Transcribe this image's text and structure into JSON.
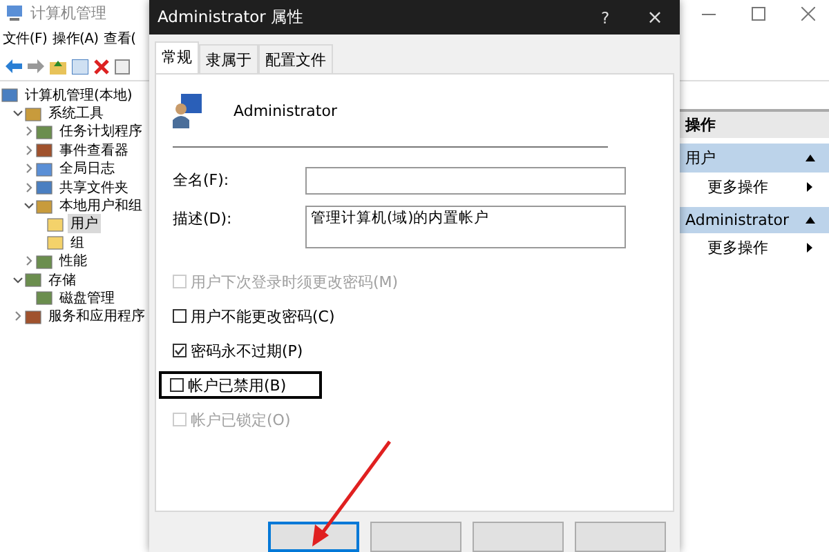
{
  "main_window": {
    "title": "计算机管理",
    "menu": [
      "文件(F)",
      "操作(A)",
      "查看("
    ],
    "tree": [
      {
        "label": "计算机管理(本地)",
        "selected": false,
        "children": [
          {
            "label": "系统工具",
            "expanded": true,
            "selected": false,
            "children": [
              {
                "label": "任务计划程序",
                "expanded": false,
                "selected": false
              },
              {
                "label": "事件查看器",
                "expanded": false,
                "selected": false
              },
              {
                "label": "全局日志",
                "expanded": false,
                "selected": false
              },
              {
                "label": "共享文件夹",
                "expanded": false,
                "selected": false
              },
              {
                "label": "本地用户和组",
                "expanded": true,
                "selected": false,
                "children": [
                  {
                    "label": "用户",
                    "selected": true
                  },
                  {
                    "label": "组",
                    "selected": false
                  }
                ]
              },
              {
                "label": "性能",
                "expanded": false,
                "selected": false
              }
            ]
          },
          {
            "label": "存储",
            "expanded": true,
            "selected": false,
            "children": [
              {
                "label": "磁盘管理",
                "selected": false
              }
            ]
          },
          {
            "label": "服务和应用程序",
            "expanded": false,
            "selected": false
          }
        ]
      }
    ],
    "actions": {
      "title": "操作",
      "sections": [
        {
          "title": "用户",
          "items": [
            "更多操作"
          ]
        },
        {
          "title": "Administrator",
          "items": [
            "更多操作"
          ]
        }
      ]
    }
  },
  "dialog": {
    "title": "Administrator 属性",
    "help": "?",
    "close": "×",
    "tabs": [
      {
        "label": "常规",
        "selected": true
      },
      {
        "label": "隶属于",
        "selected": false
      },
      {
        "label": "配置文件",
        "selected": false
      }
    ],
    "user_name": "Administrator",
    "fields": [
      {
        "label": "全名(F):",
        "multiline": false
      },
      {
        "label": "描述(D):",
        "value": "管理计算机(域)的内置帐户",
        "multiline": true
      }
    ],
    "options": [
      {
        "label": "用户下次登录时须更改密码(M)",
        "checked": false,
        "disabled": true,
        "highlighted": false
      },
      {
        "label": "用户不能更改密码(C)",
        "checked": false,
        "disabled": false,
        "highlighted": false
      },
      {
        "label": "密码永不过期(P)",
        "checked": true,
        "disabled": false,
        "highlighted": false
      },
      {
        "label": "帐户已禁用(B)",
        "checked": false,
        "disabled": false,
        "highlighted": true
      },
      {
        "label": "帐户已锁定(O)",
        "checked": false,
        "disabled": true,
        "highlighted": false
      }
    ]
  }
}
